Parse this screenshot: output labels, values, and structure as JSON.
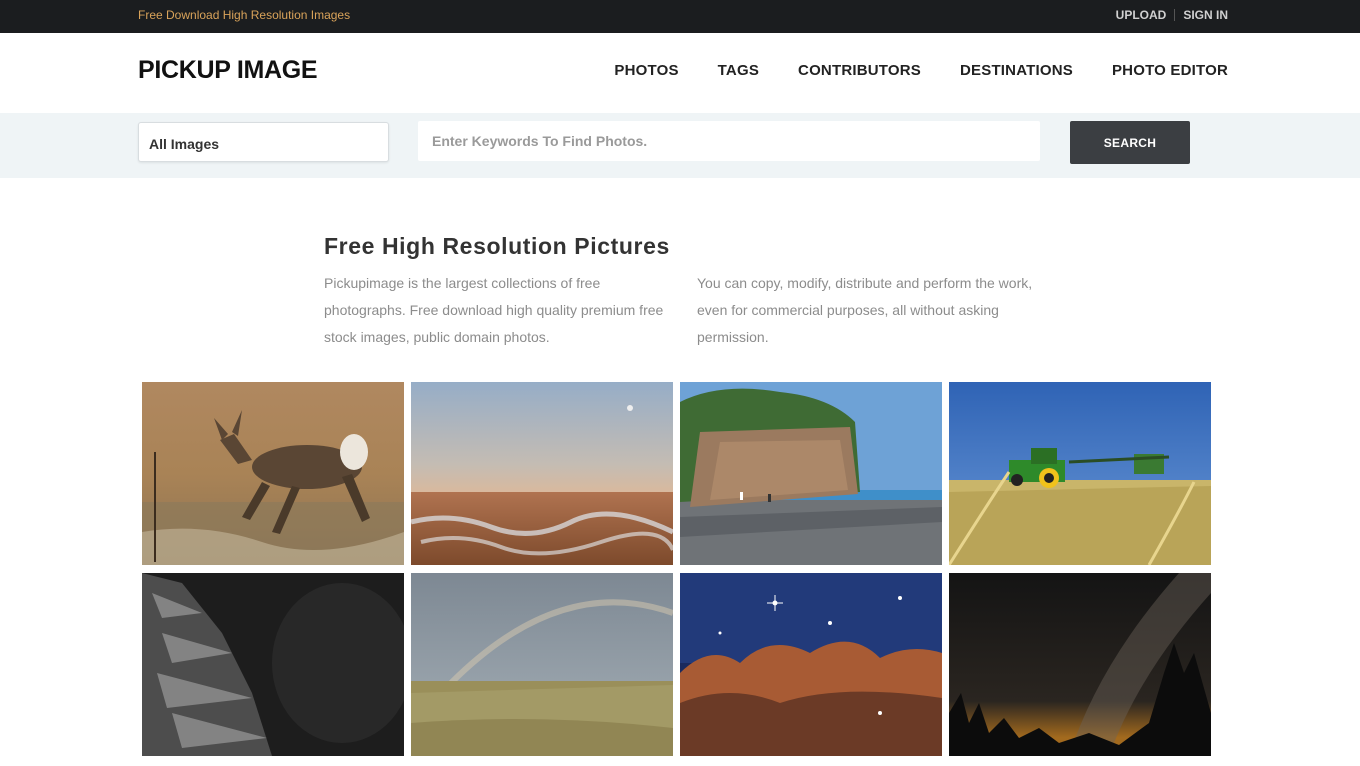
{
  "topbar": {
    "tagline": "Free Download High Resolution Images",
    "upload": "UPLOAD",
    "signin": "SIGN IN"
  },
  "header": {
    "logo": "PICKUP IMAGE",
    "nav": [
      "PHOTOS",
      "TAGS",
      "CONTRIBUTORS",
      "DESTINATIONS",
      "PHOTO EDITOR"
    ]
  },
  "search": {
    "category": "All Images",
    "placeholder": "Enter Keywords To Find Photos.",
    "button": "SEARCH"
  },
  "intro": {
    "title": "Free High Resolution Pictures",
    "left": "Pickupimage is the largest collections of free photographs. Free download high quality premium free stock images, public domain photos.",
    "right": "You can copy, modify, distribute and perform the work, even for commercial purposes, all without asking permission."
  },
  "colors": {
    "topbar_bg": "#1b1d1f",
    "tagline": "#d9a35a",
    "search_band": "#eff4f6",
    "search_button": "#3b3e42"
  }
}
